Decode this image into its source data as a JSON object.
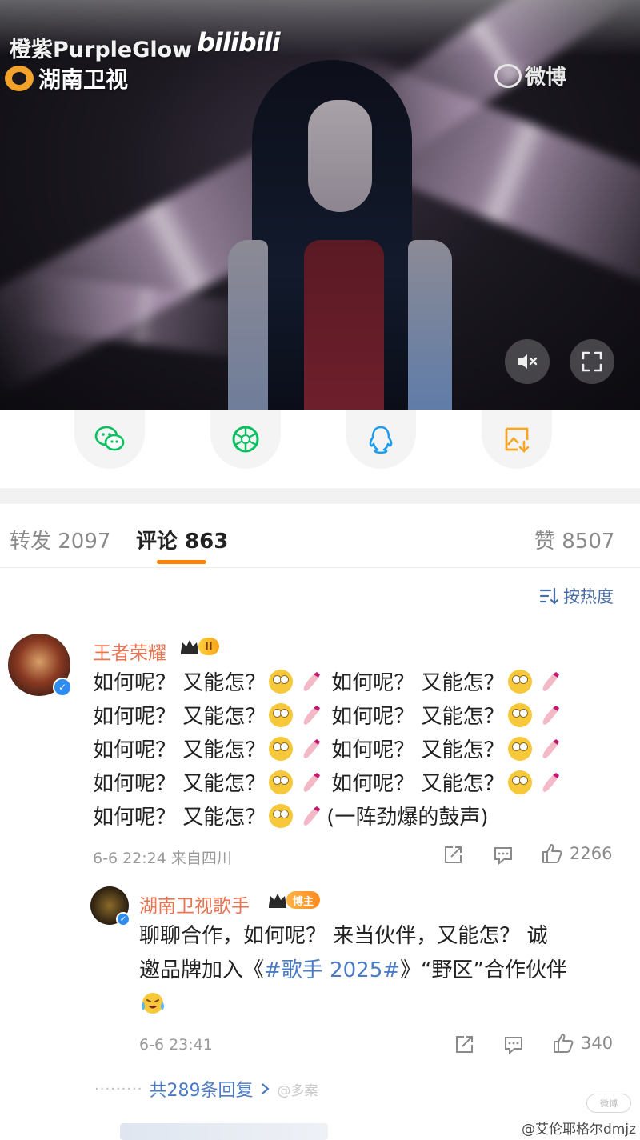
{
  "video": {
    "watermark_user": "橙紫PurpleGlow",
    "watermark_bilibili": "bilibili",
    "channel_logo_text": "湖南卫视",
    "weibo_watermark": "微博",
    "mute_icon": "speaker-muted-icon",
    "fullscreen_icon": "fullscreen-icon"
  },
  "share": {
    "items": [
      {
        "name": "wechat",
        "icon": "wechat-icon",
        "color": "#07c160"
      },
      {
        "name": "moments",
        "icon": "moments-icon",
        "color": "#07c160"
      },
      {
        "name": "qq",
        "icon": "qq-icon",
        "color": "#1e9cf0"
      },
      {
        "name": "save-image",
        "icon": "save-image-icon",
        "color": "#f5a623"
      }
    ]
  },
  "tabs": {
    "repost": "转发 2097",
    "comments": "评论 863",
    "likes": "赞 8507",
    "accent": "#ff8200"
  },
  "sort": {
    "label": "按热度"
  },
  "comments": [
    {
      "user": "王者荣耀",
      "badge": "II",
      "lines": [
        {
          "a": "如何呢？ 又能怎？",
          "b": "如何呢？ 又能怎？"
        },
        {
          "a": "如何呢？ 又能怎？",
          "b": "如何呢？ 又能怎？"
        },
        {
          "a": "如何呢？ 又能怎？",
          "b": "如何呢？ 又能怎？"
        },
        {
          "a": "如何呢？ 又能怎？",
          "b": "如何呢？ 又能怎？"
        }
      ],
      "last_line_prefix": "如何呢？ 又能怎？",
      "last_line_suffix": "(一阵劲爆的鼓声)",
      "time_location": "6-6 22:24 来自四川",
      "likes": "2266"
    },
    {
      "user": "湖南卫视歌手",
      "badge": "博主",
      "text_1": "聊聊合作，如何呢？ 来当伙伴，又能怎？ 诚",
      "text_2_pre": "邀品牌加入《",
      "hashtag": "#歌手 2025#",
      "text_2_post": "》“野区”合作伙伴",
      "time": "6-6 23:41",
      "likes": "340"
    }
  ],
  "more_replies": "共289条回复",
  "more_replies_ghost": "@多案",
  "footer": {
    "watermark": "@艾伦耶格尔dmjz",
    "pill": "微博"
  }
}
